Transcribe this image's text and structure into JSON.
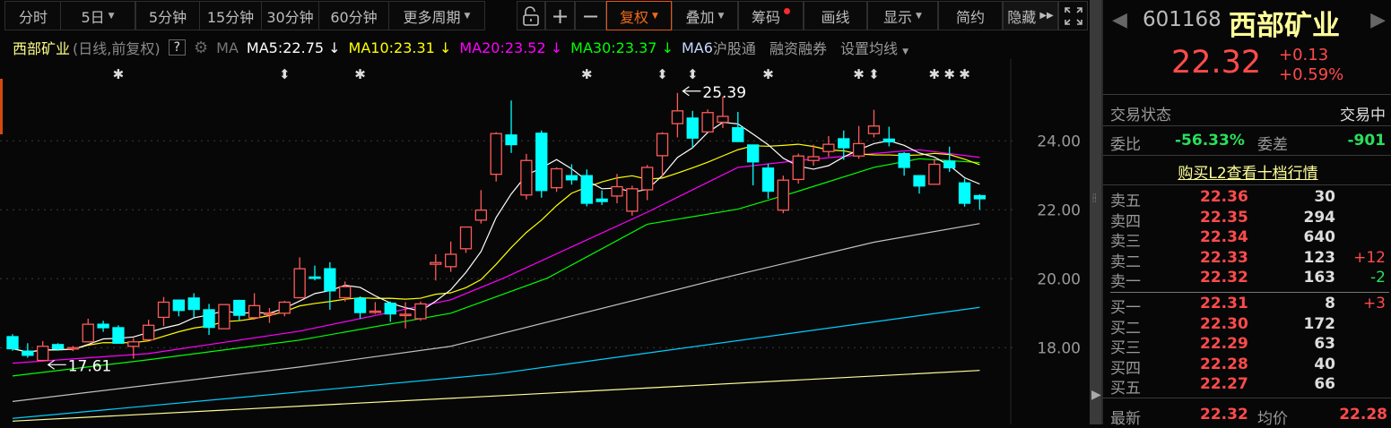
{
  "toolbar": {
    "periods": [
      {
        "label": "分时"
      },
      {
        "label": "5日",
        "dropdown": true
      },
      {
        "label": "5分钟"
      },
      {
        "label": "15分钟"
      },
      {
        "label": "30分钟"
      },
      {
        "label": "60分钟"
      },
      {
        "label": "更多周期",
        "dropdown": true
      }
    ],
    "tools": {
      "plus": "+",
      "minus": "−",
      "fuquan": "复权",
      "diejia": "叠加",
      "chouma": "筹码",
      "huaxian": "画线",
      "xianshi": "显示",
      "jianyue": "简约",
      "yincang": "隐藏"
    }
  },
  "legend": {
    "name": "西部矿业",
    "mode": "(日线,前复权)",
    "help": "?",
    "ma": "MA",
    "ma5": "MA5:22.75",
    "ma10": "MA10:23.31",
    "ma20": "MA20:23.52",
    "ma30": "MA30:23.37",
    "ma6": "MA6",
    "hgt": "沪股通",
    "rzrq": "融资融券",
    "setma": "设置均线",
    "arrow": "↓"
  },
  "colors": {
    "up": "#ff5a5a",
    "down": "#00ffff",
    "ma5": "#ffffff",
    "ma10": "#ffff00",
    "ma20": "#ff00ff",
    "ma30": "#00ff00",
    "ma60": "#c0c0c0",
    "ma120": "#00d0ff",
    "ma250": "#ffff99",
    "accent": "#f06a1a"
  },
  "chart_data": {
    "type": "candlestick",
    "ylim": [
      15.85,
      26.45
    ],
    "yticks": [
      "24.00",
      "22.00",
      "20.00",
      "18.00"
    ],
    "candles": [
      [
        18.32,
        18.39,
        17.91,
        17.97
      ],
      [
        17.9,
        18.13,
        17.71,
        17.78
      ],
      [
        17.63,
        18.19,
        17.61,
        18.04
      ],
      [
        18.09,
        18.13,
        17.91,
        17.97
      ],
      [
        17.98,
        18.05,
        17.9,
        18.0
      ],
      [
        18.17,
        18.84,
        18.17,
        18.68
      ],
      [
        18.68,
        18.78,
        18.46,
        18.58
      ],
      [
        18.58,
        18.65,
        18.13,
        18.13
      ],
      [
        18.04,
        18.28,
        17.68,
        18.17
      ],
      [
        18.23,
        18.81,
        18.23,
        18.65
      ],
      [
        18.88,
        19.47,
        18.63,
        19.32
      ],
      [
        19.38,
        19.38,
        18.91,
        19.08
      ],
      [
        19.44,
        19.58,
        18.88,
        19.11
      ],
      [
        19.1,
        19.27,
        18.37,
        18.59
      ],
      [
        18.55,
        19.25,
        18.55,
        19.25
      ],
      [
        19.37,
        19.39,
        18.78,
        18.94
      ],
      [
        18.87,
        19.58,
        18.81,
        19.22
      ],
      [
        19.0,
        19.15,
        18.72,
        19.0
      ],
      [
        19.0,
        19.36,
        18.91,
        19.32
      ],
      [
        19.45,
        20.62,
        19.43,
        20.29
      ],
      [
        20.05,
        20.38,
        19.95,
        20.02
      ],
      [
        20.29,
        20.48,
        19.1,
        19.65
      ],
      [
        19.45,
        19.92,
        19.34,
        19.77
      ],
      [
        19.43,
        19.49,
        18.84,
        19.02
      ],
      [
        19.04,
        19.32,
        18.98,
        19.06
      ],
      [
        19.29,
        19.34,
        18.75,
        18.98
      ],
      [
        18.95,
        19.32,
        18.56,
        18.97
      ],
      [
        18.84,
        19.34,
        18.78,
        19.27
      ],
      [
        20.42,
        20.71,
        19.95,
        20.47
      ],
      [
        20.35,
        21.08,
        20.2,
        20.71
      ],
      [
        20.87,
        21.5,
        20.75,
        21.5
      ],
      [
        21.7,
        22.57,
        21.6,
        21.99
      ],
      [
        23.03,
        24.25,
        22.82,
        24.21
      ],
      [
        24.17,
        25.17,
        23.65,
        23.89
      ],
      [
        22.43,
        23.62,
        22.3,
        23.43
      ],
      [
        24.22,
        24.3,
        22.35,
        22.56
      ],
      [
        22.64,
        23.23,
        22.52,
        23.19
      ],
      [
        22.99,
        23.32,
        22.73,
        22.87
      ],
      [
        22.99,
        23.17,
        22.1,
        22.19
      ],
      [
        22.31,
        22.56,
        22.14,
        22.24
      ],
      [
        22.4,
        23.04,
        22.19,
        22.67
      ],
      [
        21.96,
        22.7,
        21.83,
        22.61
      ],
      [
        22.58,
        23.3,
        22.28,
        23.23
      ],
      [
        23.57,
        24.25,
        22.95,
        24.21
      ],
      [
        24.5,
        25.39,
        24.1,
        24.87
      ],
      [
        24.66,
        24.87,
        23.8,
        24.08
      ],
      [
        24.26,
        24.91,
        24.26,
        24.82
      ],
      [
        24.54,
        25.28,
        24.37,
        24.71
      ],
      [
        24.38,
        24.84,
        23.97,
        23.98
      ],
      [
        23.88,
        23.88,
        22.71,
        23.39
      ],
      [
        23.21,
        23.34,
        22.32,
        22.54
      ],
      [
        21.99,
        22.99,
        21.9,
        22.86
      ],
      [
        22.88,
        23.63,
        22.76,
        23.56
      ],
      [
        23.43,
        23.89,
        23.28,
        23.54
      ],
      [
        23.69,
        24.14,
        23.54,
        23.9
      ],
      [
        24.06,
        24.3,
        23.45,
        23.8
      ],
      [
        23.56,
        24.43,
        23.48,
        23.92
      ],
      [
        24.21,
        24.9,
        24.1,
        24.43
      ],
      [
        24.05,
        24.41,
        23.84,
        23.97
      ],
      [
        23.63,
        23.67,
        22.99,
        23.23
      ],
      [
        22.99,
        22.99,
        22.47,
        22.69
      ],
      [
        22.74,
        23.48,
        22.74,
        23.32
      ],
      [
        23.41,
        23.83,
        23.1,
        23.22
      ],
      [
        22.78,
        22.9,
        22.09,
        22.19
      ],
      [
        22.41,
        22.45,
        22.0,
        22.32
      ]
    ],
    "ma_lines": {
      "ma20": [
        [
          0,
          17.55
        ],
        [
          9,
          17.83
        ],
        [
          19,
          18.48
        ],
        [
          29,
          19.39
        ],
        [
          32.5,
          20.02
        ],
        [
          42,
          21.93
        ],
        [
          48,
          23.23
        ],
        [
          52,
          23.43
        ],
        [
          58,
          23.67
        ],
        [
          60,
          23.74
        ],
        [
          64,
          23.52
        ]
      ],
      "ma30": [
        [
          0,
          17.18
        ],
        [
          9,
          17.65
        ],
        [
          19,
          18.22
        ],
        [
          29,
          19.0
        ],
        [
          35.4,
          20.02
        ],
        [
          42,
          21.58
        ],
        [
          48,
          22.02
        ],
        [
          52,
          22.54
        ],
        [
          57,
          23.23
        ],
        [
          60,
          23.48
        ],
        [
          64,
          23.37
        ]
      ],
      "ma60": [
        [
          0,
          16.44
        ],
        [
          19,
          17.44
        ],
        [
          29,
          18.04
        ],
        [
          47,
          20.02
        ],
        [
          57,
          21.06
        ],
        [
          64,
          21.6
        ]
      ],
      "ma120": [
        [
          0,
          15.95
        ],
        [
          32,
          17.24
        ],
        [
          64,
          19.17
        ]
      ],
      "ma250": [
        [
          0,
          15.87
        ],
        [
          32,
          16.6
        ],
        [
          64,
          17.34
        ]
      ]
    },
    "annotations": [
      {
        "label": "25.39",
        "index": 44,
        "value": 25.39
      },
      {
        "label": "17.61",
        "index": 2,
        "value": 17.61
      }
    ],
    "signals": [
      {
        "index": 7,
        "glyph": "✱"
      },
      {
        "index": 18,
        "glyph": "⬍"
      },
      {
        "index": 23,
        "glyph": "✱"
      },
      {
        "index": 38,
        "glyph": "✱"
      },
      {
        "index": 43,
        "glyph": "⬍"
      },
      {
        "index": 45,
        "glyph": "⬍"
      },
      {
        "index": 50,
        "glyph": "✱"
      },
      {
        "index": 56,
        "glyph": "✱"
      },
      {
        "index": 57,
        "glyph": "⬍"
      },
      {
        "index": 61,
        "glyph": "✱"
      },
      {
        "index": 62,
        "glyph": "✱"
      },
      {
        "index": 63,
        "glyph": "✱"
      }
    ]
  },
  "quote": {
    "code": "601168",
    "name": "西部矿业",
    "price": "22.32",
    "change": "+0.13",
    "pct": "+0.59%",
    "status_label": "交易状态",
    "status": "交易中",
    "wb_label": "委比",
    "wb": "-56.33%",
    "wc_label": "委差",
    "wc": "-901",
    "l2": "购买L2查看十档行情",
    "sells": [
      {
        "label": "卖五",
        "price": "22.36",
        "vol": "30",
        "chg": ""
      },
      {
        "label": "卖四",
        "price": "22.35",
        "vol": "294",
        "chg": ""
      },
      {
        "label": "卖三",
        "price": "22.34",
        "vol": "640",
        "chg": ""
      },
      {
        "label": "卖二",
        "price": "22.33",
        "vol": "123",
        "chg": "+12"
      },
      {
        "label": "卖一",
        "price": "22.32",
        "vol": "163",
        "chg": "-2"
      }
    ],
    "buys": [
      {
        "label": "买一",
        "price": "22.31",
        "vol": "8",
        "chg": "+3"
      },
      {
        "label": "买二",
        "price": "22.30",
        "vol": "172",
        "chg": ""
      },
      {
        "label": "买三",
        "price": "22.29",
        "vol": "63",
        "chg": ""
      },
      {
        "label": "买四",
        "price": "22.28",
        "vol": "40",
        "chg": ""
      },
      {
        "label": "买五",
        "price": "22.27",
        "vol": "66",
        "chg": ""
      }
    ],
    "last_label": "最新",
    "last": "22.32",
    "avg_label": "均价",
    "avg": "22.28"
  }
}
